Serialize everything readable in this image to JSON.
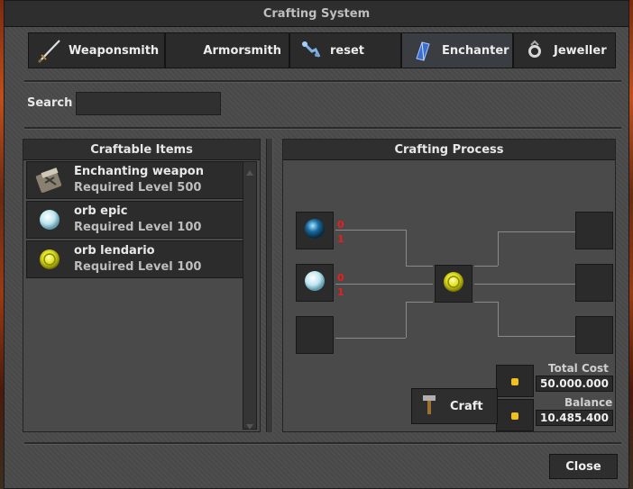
{
  "window": {
    "title": "Crafting System"
  },
  "tabs": [
    {
      "label": "Weaponsmith",
      "icon": "sword-icon"
    },
    {
      "label": "Armorsmith",
      "icon": ""
    },
    {
      "label": "reset",
      "icon": "wand-icon"
    },
    {
      "label": "Enchanter",
      "icon": "crystal-icon",
      "active": true
    },
    {
      "label": "Jeweller",
      "icon": "gem-pouch-icon"
    }
  ],
  "search": {
    "label": "Search",
    "value": ""
  },
  "craftable": {
    "title": "Craftable Items",
    "items": [
      {
        "name": "Enchanting weapon",
        "req": "Required Level 500",
        "icon": "enchant-scroll-icon"
      },
      {
        "name": "orb epic",
        "req": "Required Level 100",
        "icon": "white-orb-icon"
      },
      {
        "name": "orb lendario",
        "req": "Required Level 100",
        "icon": "yellow-orb-icon"
      }
    ]
  },
  "process": {
    "title": "Crafting Process",
    "inputs": [
      {
        "icon": "blue-orb-icon",
        "have": "0",
        "need": "1"
      },
      {
        "icon": "white-orb-icon",
        "have": "0",
        "need": "1"
      }
    ],
    "result_icon": "yellow-orb-icon"
  },
  "cost": {
    "total_label": "Total Cost",
    "total": "50.000.000",
    "balance_label": "Balance",
    "balance": "10.485.400"
  },
  "buttons": {
    "craft": "Craft",
    "close": "Close"
  },
  "colors": {
    "count": "#ee1c1c",
    "active_tab": "#3a3d42"
  }
}
